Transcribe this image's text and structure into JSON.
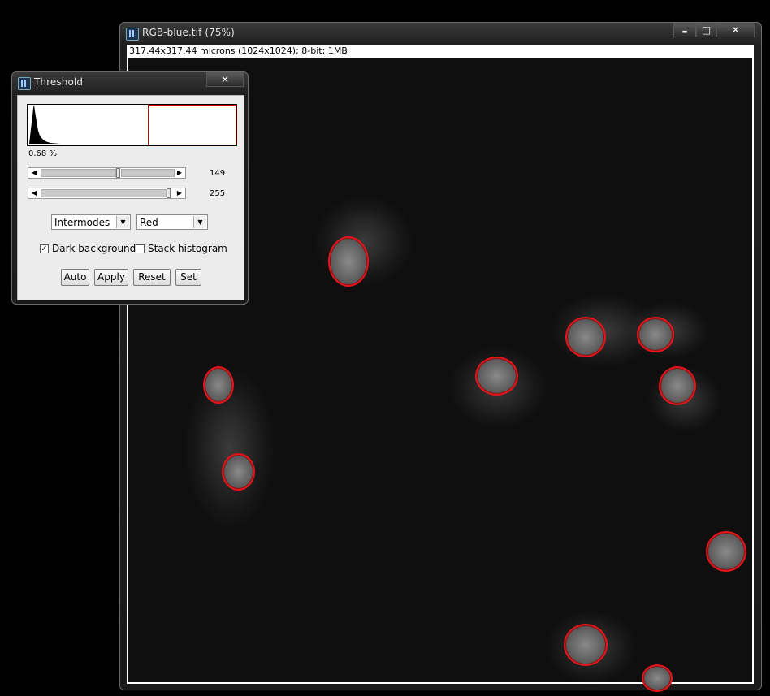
{
  "image_window": {
    "title": "RGB-blue.tif (75%)",
    "info": "317.44x317.44 microns (1024x1024); 8-bit; 1MB",
    "minimize_glyph": "▬",
    "maximize_glyph": "□",
    "close_glyph": "✕"
  },
  "threshold": {
    "title": "Threshold",
    "close_glyph": "✕",
    "percent": "0.68 %",
    "min_value": "149",
    "max_value": "255",
    "method": "Intermodes",
    "display": "Red",
    "dark_background_label": "Dark background",
    "dark_background_checked": "✓",
    "stack_histogram_label": "Stack histogram",
    "buttons": {
      "auto": "Auto",
      "apply": "Apply",
      "reset": "Reset",
      "set": "Set"
    },
    "arrow_left": "◀",
    "arrow_right": "▶",
    "dropdown_arrow": "▼"
  },
  "colors": {
    "overlay": "#e3141a",
    "titlebar": "#2a2a2a",
    "dialog_bg": "#ececec"
  },
  "icons": [
    "imagej-icon",
    "minimize-icon",
    "maximize-icon",
    "close-icon"
  ]
}
